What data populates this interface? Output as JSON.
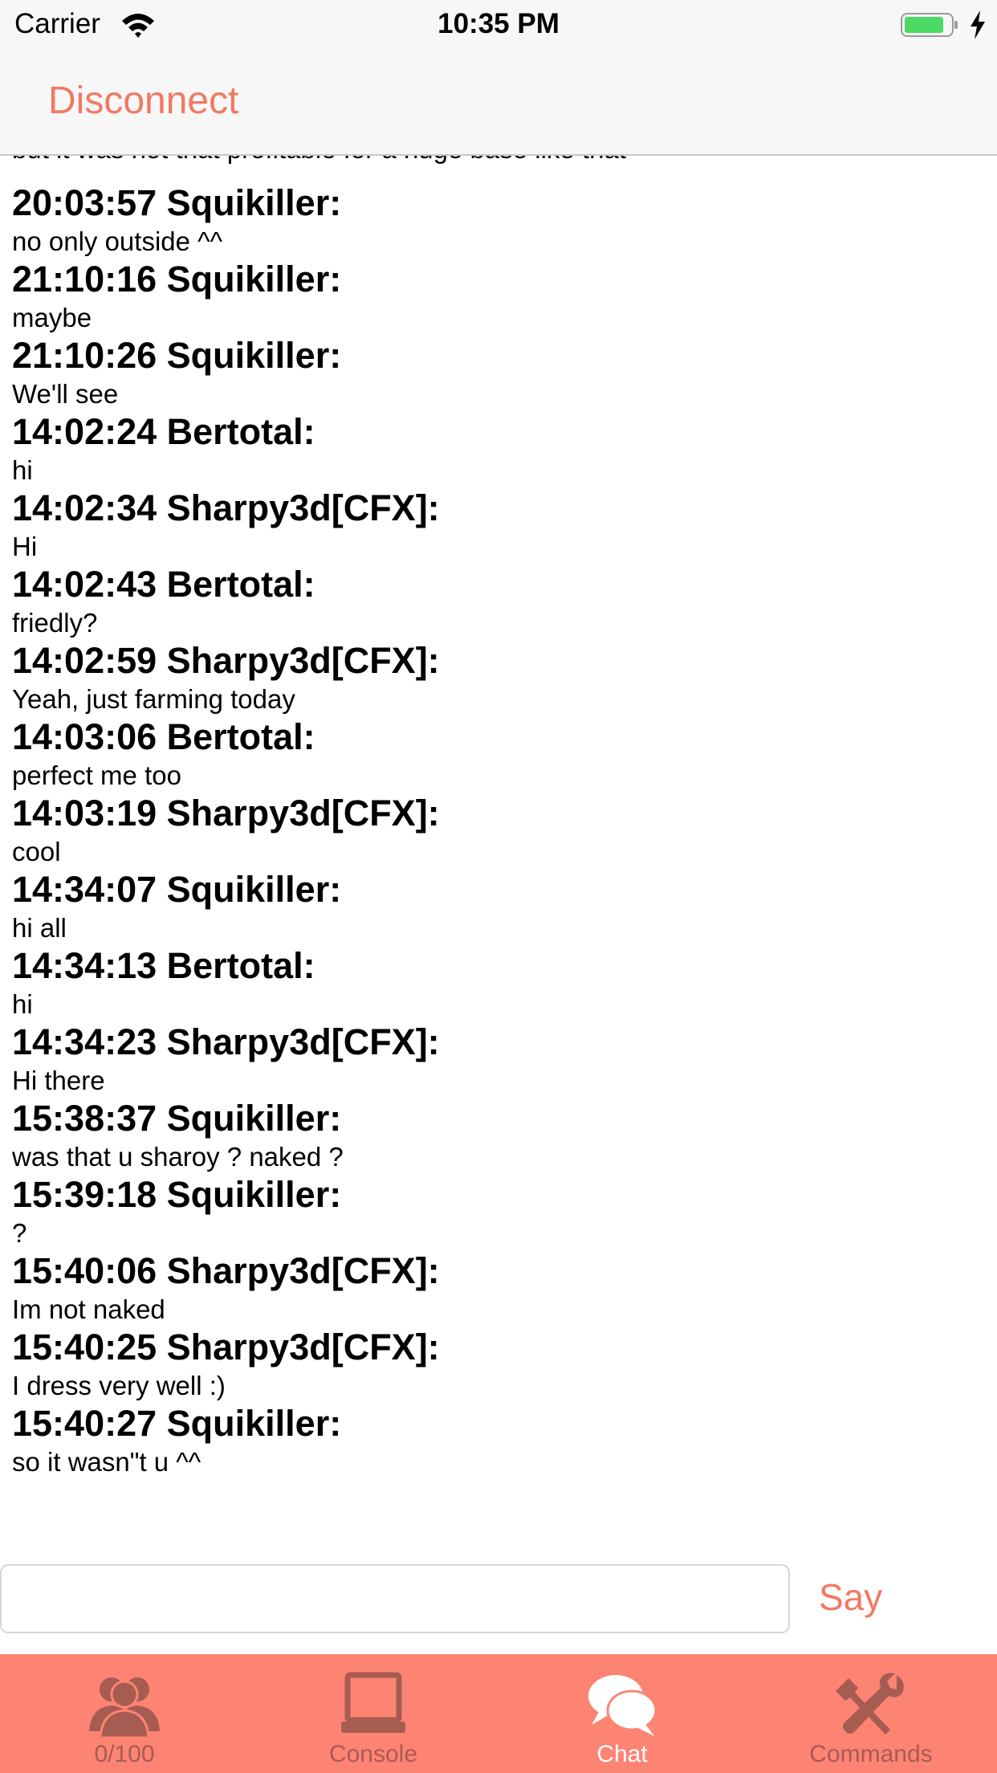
{
  "status_bar": {
    "carrier": "Carrier",
    "time": "10:35 PM"
  },
  "nav": {
    "disconnect_label": "Disconnect"
  },
  "chat": {
    "cutoff_text": "but it was not that profitable for a huge base like that",
    "messages": [
      {
        "header": "20:03:57 Squikiller:",
        "text": "no only outside ^^"
      },
      {
        "header": "21:10:16 Squikiller:",
        "text": "maybe"
      },
      {
        "header": "21:10:26 Squikiller:",
        "text": "We'll see"
      },
      {
        "header": "14:02:24 Bertotal:",
        "text": "hi"
      },
      {
        "header": "14:02:34 Sharpy3d[CFX]:",
        "text": "Hi"
      },
      {
        "header": "14:02:43 Bertotal:",
        "text": "friedly?"
      },
      {
        "header": "14:02:59 Sharpy3d[CFX]:",
        "text": "Yeah, just farming today"
      },
      {
        "header": "14:03:06 Bertotal:",
        "text": "perfect me too"
      },
      {
        "header": "14:03:19 Sharpy3d[CFX]:",
        "text": "cool"
      },
      {
        "header": "14:34:07 Squikiller:",
        "text": "hi all"
      },
      {
        "header": "14:34:13 Bertotal:",
        "text": "hi"
      },
      {
        "header": "14:34:23 Sharpy3d[CFX]:",
        "text": "Hi there"
      },
      {
        "header": "15:38:37 Squikiller:",
        "text": "was that u sharoy ? naked ?"
      },
      {
        "header": "15:39:18 Squikiller:",
        "text": "?"
      },
      {
        "header": "15:40:06 Sharpy3d[CFX]:",
        "text": "Im not naked"
      },
      {
        "header": "15:40:25 Sharpy3d[CFX]:",
        "text": "I dress very well :)"
      },
      {
        "header": "15:40:27 Squikiller:",
        "text": "so it wasn\"t u ^^"
      }
    ]
  },
  "input": {
    "value": "",
    "placeholder": "",
    "say_label": "Say"
  },
  "tabs": [
    {
      "label": "0/100",
      "icon": "players-icon",
      "active": false
    },
    {
      "label": "Console",
      "icon": "console-icon",
      "active": false
    },
    {
      "label": "Chat",
      "icon": "chat-icon",
      "active": true
    },
    {
      "label": "Commands",
      "icon": "commands-icon",
      "active": false
    }
  ],
  "colors": {
    "accent": "#f07a64",
    "tab_bar": "#fd8373",
    "tab_inactive": "#a75c52",
    "tab_active": "#ffffff"
  }
}
